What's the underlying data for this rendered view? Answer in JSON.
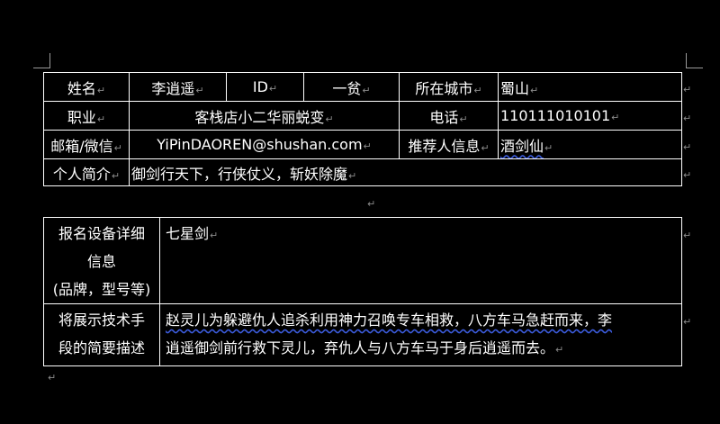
{
  "form": {
    "row1": {
      "name_label": "姓名",
      "name_value": "李逍遥",
      "id_label": "ID",
      "id_value": "一贫",
      "city_label": "所在城市",
      "city_value": "蜀山"
    },
    "row2": {
      "job_label": "职业",
      "job_value": "客栈店小二华丽蜕变",
      "phone_label": "电话",
      "phone_value": "110111010101"
    },
    "row3": {
      "email_label": "邮箱/微信",
      "email_value": "YiPinDAOREN@shushan.com",
      "referrer_label": "推荐人信息",
      "referrer_value": "酒剑仙"
    },
    "row4": {
      "intro_label": "个人简介",
      "intro_value": "御剑行天下，行侠仗义，斩妖除魔"
    }
  },
  "details": {
    "equipment_label_1": "报名设备详细",
    "equipment_label_2": "信息",
    "equipment_label_3": "(品牌，型号等)",
    "equipment_value": "七星剑",
    "technique_label_1": "将展示技术手",
    "technique_label_2": "段的简要描述",
    "technique_value_1": "赵灵儿为躲避仇人追杀利用神力召唤专车相救，八方车马急赶而来，李",
    "technique_value_2": "逍遥御剑前行救下灵儿，弃仇人与八方车马于身后逍遥而去。"
  },
  "marks": {
    "cell_mark": "↵",
    "paragraph_mark": "↵"
  }
}
